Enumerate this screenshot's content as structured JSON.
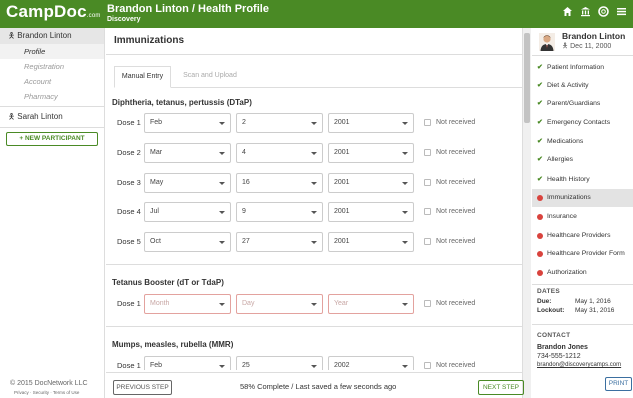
{
  "topbar": {
    "logo": "CampDoc",
    "logo_suffix": ".com",
    "title": "Brandon Linton / Health Profile",
    "subtitle": "Discovery",
    "icons": [
      "home-icon",
      "bank-icon",
      "help-icon",
      "menu-icon"
    ]
  },
  "sidebar": {
    "participants": [
      {
        "name": "Brandon Linton",
        "active": true,
        "subitems": [
          "Profile",
          "Registration",
          "Account",
          "Pharmacy"
        ]
      },
      {
        "name": "Sarah Linton",
        "active": false
      }
    ],
    "new_participant": "+ NEW PARTICIPANT",
    "copyright": "© 2015 DocNetwork LLC",
    "footer_links": "Privacy · Security · Terms of Use"
  },
  "main": {
    "title": "Immunizations",
    "tabs": [
      "Manual Entry",
      "Scan and Upload"
    ],
    "not_received_label": "Not received",
    "sections": [
      {
        "title": "Diphtheria, tetanus, pertussis (DTaP)",
        "doses": [
          {
            "label": "Dose 1",
            "month": "Feb",
            "day": "2",
            "year": "2001"
          },
          {
            "label": "Dose 2",
            "month": "Mar",
            "day": "4",
            "year": "2001"
          },
          {
            "label": "Dose 3",
            "month": "May",
            "day": "16",
            "year": "2001"
          },
          {
            "label": "Dose 4",
            "month": "Jul",
            "day": "9",
            "year": "2001"
          },
          {
            "label": "Dose 5",
            "month": "Oct",
            "day": "27",
            "year": "2001"
          }
        ]
      },
      {
        "title": "Tetanus Booster (dT or TdaP)",
        "doses": [
          {
            "label": "Dose 1",
            "month_placeholder": "Month",
            "day_placeholder": "Day",
            "year_placeholder": "Year"
          }
        ]
      },
      {
        "title": "Mumps, measles, rubella (MMR)",
        "doses": [
          {
            "label": "Dose 1",
            "month": "Feb",
            "day": "25",
            "year": "2002"
          }
        ]
      }
    ]
  },
  "bottombar": {
    "prev": "PREVIOUS STEP",
    "progress": "58% Complete / Last saved a few seconds ago",
    "next": "NEXT STEP"
  },
  "right": {
    "name": "Brandon Linton",
    "dob": "Dec 11, 2000",
    "nav": [
      {
        "label": "Patient Information",
        "status": "done"
      },
      {
        "label": "Diet & Activity",
        "status": "done"
      },
      {
        "label": "Parent/Guardians",
        "status": "done"
      },
      {
        "label": "Emergency Contacts",
        "status": "done"
      },
      {
        "label": "Medications",
        "status": "done"
      },
      {
        "label": "Allergies",
        "status": "done"
      },
      {
        "label": "Health History",
        "status": "done"
      },
      {
        "label": "Immunizations",
        "status": "todo"
      },
      {
        "label": "Insurance",
        "status": "todo"
      },
      {
        "label": "Healthcare Providers",
        "status": "todo"
      },
      {
        "label": "Healthcare Provider Form",
        "status": "todo"
      },
      {
        "label": "Authorization",
        "status": "todo"
      }
    ],
    "dates_heading": "DATES",
    "due_label": "Due:",
    "due": "May 1, 2016",
    "lockout_label": "Lockout:",
    "lockout": "May 31, 2016",
    "contact_heading": "CONTACT",
    "contact_name": "Brandon Jones",
    "contact_phone": "734-555-1212",
    "contact_email": "brandon@discoverycamps.com",
    "print": "PRINT"
  },
  "colors": {
    "brand_green": "#4a8a25",
    "incomplete_red": "#d9433d"
  }
}
